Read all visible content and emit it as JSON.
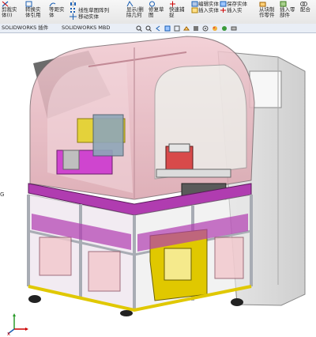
{
  "ribbon": {
    "items": [
      {
        "label_lines": [
          "剪裁实",
          "体(I)"
        ]
      },
      {
        "label_lines": [
          "转换实",
          "体引用"
        ]
      },
      {
        "label_lines": [
          "等距实",
          "体"
        ]
      },
      {
        "label_lines": [
          "线性草图阵列"
        ]
      },
      {
        "label_lines": [
          "移动实体"
        ]
      },
      {
        "label_lines": [
          "显示/删",
          "除几何"
        ]
      },
      {
        "label_lines": [
          "修复草",
          "图"
        ]
      },
      {
        "label_lines": [
          "快速捕",
          "捉"
        ]
      },
      {
        "label_lines": [
          "编辑实",
          "体"
        ]
      },
      {
        "label_lines": [
          "插入实",
          "体"
        ]
      },
      {
        "label_lines": [
          "保存实",
          "体"
        ]
      },
      {
        "label_lines": [
          "插入实"
        ]
      },
      {
        "label_lines": [
          "从块制",
          "作零件"
        ]
      },
      {
        "label_lines": [
          "插入零",
          "部件"
        ]
      },
      {
        "label_lines": [
          "配合"
        ]
      },
      {
        "label_lines": [
          "编辑块"
        ]
      },
      {
        "label_lines": [
          "插入块"
        ]
      },
      {
        "label_lines": [
          "保存块"
        ]
      },
      {
        "label_lines": [
          "爆炸块"
        ]
      }
    ]
  },
  "tabs": [
    {
      "label": "SOLIDWORKS 插件"
    },
    {
      "label": "SOLIDWORKS MBD"
    }
  ],
  "triad_label": "x",
  "side_glyph": "G",
  "colors": {
    "frame": "#a8acb4",
    "base_magenta": "#b03cb0",
    "canopy": "#e6b3bd",
    "yellow": "#e0c800",
    "enclosure": "#dcdcdc"
  }
}
